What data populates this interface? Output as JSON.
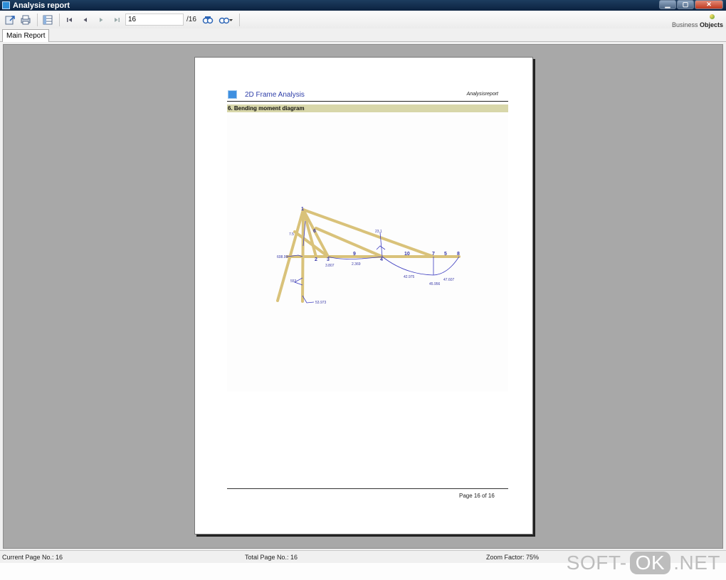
{
  "window": {
    "title": "Analysis report",
    "controls": [
      "minimize",
      "maximize",
      "close"
    ]
  },
  "toolbar": {
    "current_page_value": "16",
    "total_pages_label": "/16",
    "icons": [
      "export-icon",
      "print-icon",
      "group-tree-icon",
      "first-page-icon",
      "prev-page-icon",
      "next-page-icon",
      "last-page-icon",
      "search-icon",
      "zoom-icon"
    ],
    "brand_line1": "Business",
    "brand_line2": "Objects"
  },
  "tabs": [
    {
      "label": "Main Report"
    }
  ],
  "report": {
    "header_title": "2D Frame Analysis",
    "header_subtitle": "Analysisreport",
    "section_title": "6. Bending moment diagram",
    "page_footer": "Page 16 of 16",
    "diagram_labels": {
      "nodes": [
        "1",
        "2",
        "3",
        "4",
        "5",
        "6",
        "7",
        "8",
        "9",
        "10"
      ],
      "values": [
        "608.99",
        "553",
        "53.973",
        "3.807",
        "2.369",
        "42.975",
        "45.956",
        "47.607",
        "7.5",
        "23.1"
      ]
    }
  },
  "statusbar": {
    "current_page": "Current Page No.: 16",
    "total_pages": "Total Page No.: 16",
    "zoom": "Zoom Factor: 75%"
  },
  "watermark": {
    "left": "SOFT-",
    "mid": "OK",
    "right": ".NET"
  },
  "colors": {
    "titlebar": "#0b2240",
    "viewer_bg": "#a8a8a8",
    "section_bar": "#d8d7aa",
    "frame_member": "#d9c27a",
    "moment_line": "#3e3ec0",
    "header_text": "#2e3ea8"
  }
}
